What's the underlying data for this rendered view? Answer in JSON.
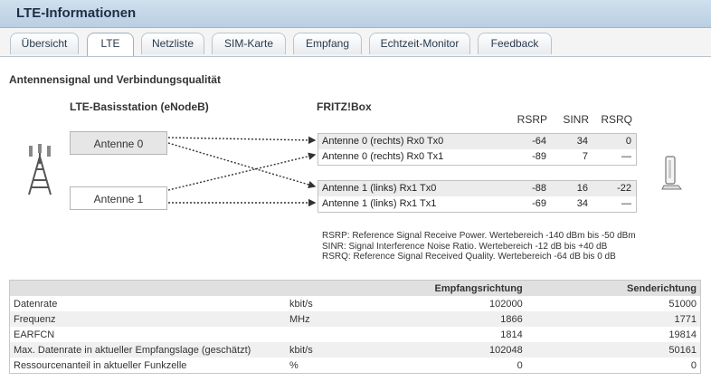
{
  "header": {
    "title": "LTE-Informationen"
  },
  "tabs": [
    {
      "label": "Übersicht",
      "active": false
    },
    {
      "label": "LTE",
      "active": true
    },
    {
      "label": "Netzliste",
      "active": false
    },
    {
      "label": "SIM-Karte",
      "active": false
    },
    {
      "label": "Empfang",
      "active": false
    },
    {
      "label": "Echtzeit-Monitor",
      "active": false
    },
    {
      "label": "Feedback",
      "active": false
    }
  ],
  "section": {
    "title": "Antennensignal und Verbindungsqualität"
  },
  "basestation": {
    "title": "LTE-Basisstation (eNodeB)",
    "antenna0": "Antenne 0",
    "antenna1": "Antenne 1"
  },
  "fritzbox": {
    "title": "FRITZ!Box",
    "columns": [
      "RSRP",
      "SINR",
      "RSRQ"
    ],
    "rows": [
      {
        "label": "Antenne 0 (rechts) Rx0 Tx0",
        "rsrp": "-64",
        "sinr": "34",
        "rsrq": "0"
      },
      {
        "label": "Antenne 0 (rechts) Rx0 Tx1",
        "rsrp": "-89",
        "sinr": "7",
        "rsrq": "—"
      },
      {
        "label": "Antenne 1 (links) Rx1 Tx0",
        "rsrp": "-88",
        "sinr": "16",
        "rsrq": "-22"
      },
      {
        "label": "Antenne 1 (links) Rx1 Tx1",
        "rsrp": "-69",
        "sinr": "34",
        "rsrq": "—"
      }
    ]
  },
  "legend": [
    "RSRP: Reference Signal Receive Power. Wertebereich -140 dBm bis -50 dBm",
    "SINR: Signal Interference Noise Ratio. Wertebereich -12 dB bis +40 dB",
    "RSRQ: Reference Signal Received Quality. Wertebereich -64 dB bis 0 dB"
  ],
  "table": {
    "headers": {
      "rx": "Empfangsrichtung",
      "tx": "Senderichtung"
    },
    "rows": [
      {
        "label": "Datenrate",
        "unit": "kbit/s",
        "rx": "102000",
        "tx": "51000"
      },
      {
        "label": "Frequenz",
        "unit": "MHz",
        "rx": "1866",
        "tx": "1771"
      },
      {
        "label": "EARFCN",
        "unit": "",
        "rx": "1814",
        "tx": "19814"
      },
      {
        "label": "Max. Datenrate in aktueller Empfangslage (geschätzt)",
        "unit": "kbit/s",
        "rx": "102048",
        "tx": "50161"
      },
      {
        "label": "Ressourcenanteil in aktueller Funkzelle",
        "unit": "%",
        "rx": "0",
        "tx": "0"
      }
    ]
  },
  "icons": {
    "tower": "cell-tower-icon",
    "router": "fritzbox-device-icon"
  },
  "colors": {
    "header_bg": "#c4d8e9",
    "title_text": "#1d2f45",
    "row_shade": "#ececec"
  }
}
